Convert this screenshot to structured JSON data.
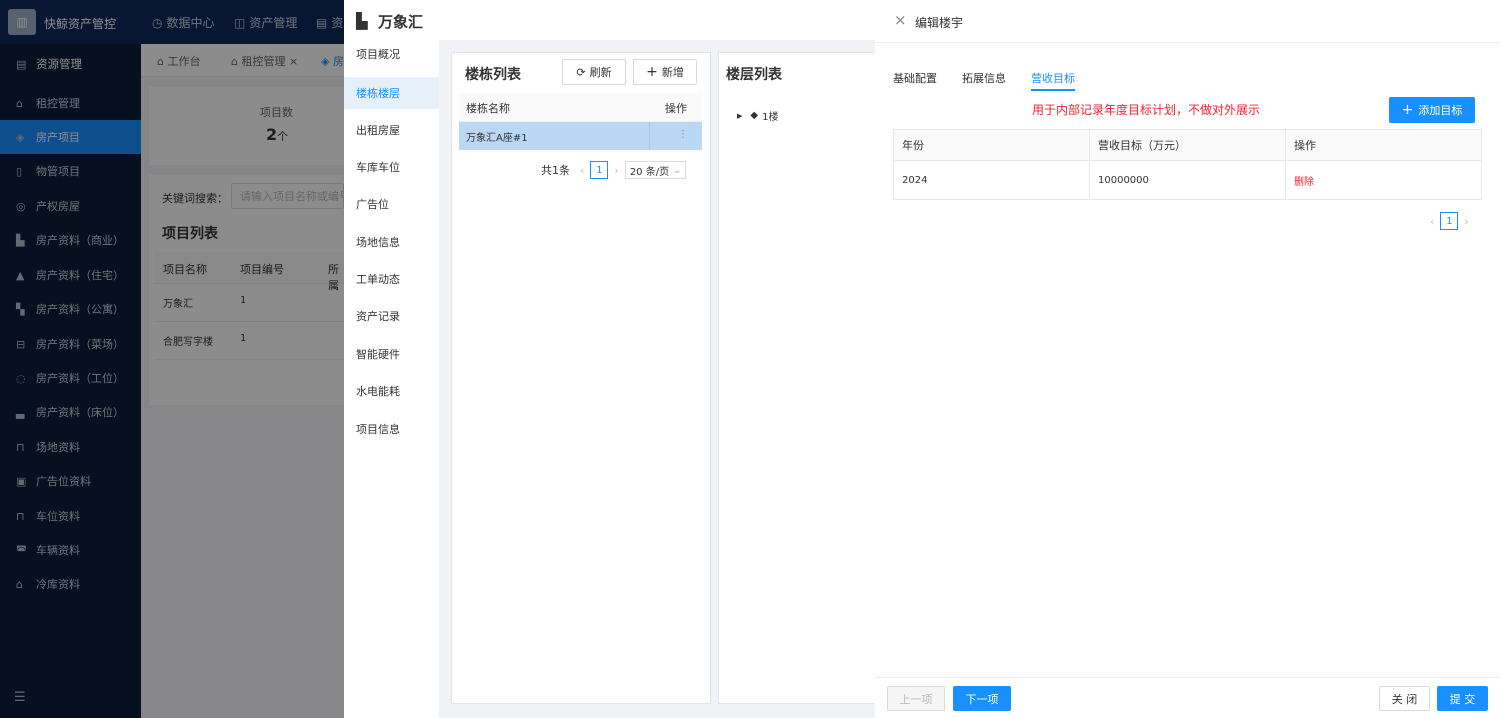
{
  "app": {
    "name": "快鲸资产管控",
    "logo_icon": "building-icon"
  },
  "topnav": [
    {
      "label": "数据中心",
      "icon": "chart-icon"
    },
    {
      "label": "资产管理",
      "icon": "cube-icon"
    },
    {
      "label": "资",
      "icon": "building-icon"
    }
  ],
  "sidebar": {
    "header": "资源管理",
    "items": [
      {
        "label": "租控管理",
        "icon": "home-icon"
      },
      {
        "label": "房产项目",
        "icon": "layers-icon",
        "active": true
      },
      {
        "label": "物管项目",
        "icon": "doc-icon"
      },
      {
        "label": "产权房屋",
        "icon": "stack-icon"
      },
      {
        "label": "房产资料（商业）",
        "icon": "shop-icon"
      },
      {
        "label": "房产资料（住宅）",
        "icon": "house-icon"
      },
      {
        "label": "房产资料（公寓）",
        "icon": "apartment-icon"
      },
      {
        "label": "房产资料（菜场）",
        "icon": "market-icon"
      },
      {
        "label": "房产资料（工位）",
        "icon": "desk-icon"
      },
      {
        "label": "房产资料（床位）",
        "icon": "bed-icon"
      },
      {
        "label": "场地资料",
        "icon": "field-icon"
      },
      {
        "label": "广告位资料",
        "icon": "ad-icon"
      },
      {
        "label": "车位资料",
        "icon": "parking-icon"
      },
      {
        "label": "车辆资料",
        "icon": "car-icon"
      },
      {
        "label": "冷库资料",
        "icon": "warehouse-icon"
      }
    ],
    "collapse_icon": "menu-fold-icon"
  },
  "worktabs": [
    "工作台",
    "租控管理",
    "房"
  ],
  "stat": {
    "label": "项目数",
    "value": "2",
    "unit": "个"
  },
  "search": {
    "label": "关键词搜索：",
    "placeholder": "请输入项目名称或编号"
  },
  "project_list": {
    "title": "项目列表",
    "columns": [
      "项目名称",
      "项目编号",
      "所属"
    ],
    "rows": [
      [
        "万象汇",
        "1"
      ],
      [
        "合肥写字楼",
        "1"
      ]
    ]
  },
  "project_drawer": {
    "title": "万象汇",
    "nav": [
      "项目概况",
      "楼栋楼层",
      "出租房屋",
      "车库车位",
      "广告位",
      "场地信息",
      "工单动态",
      "资产记录",
      "智能硬件",
      "水电能耗",
      "项目信息"
    ],
    "active_nav": 1,
    "building_panel": {
      "title": "楼栋列表",
      "refresh": "刷新",
      "add": "新增",
      "columns": [
        "楼栋名称",
        "操作"
      ],
      "rows": [
        {
          "name": "万象汇A座#1",
          "op": "⋮"
        }
      ],
      "pagination": {
        "total": "共1条",
        "page": "1",
        "size": "20 条/页"
      }
    },
    "floor_panel": {
      "title": "楼层列表",
      "floors": [
        "1楼"
      ]
    }
  },
  "edit_drawer": {
    "title": "编辑楼宇",
    "tabs": [
      "基础配置",
      "拓展信息",
      "营收目标"
    ],
    "active_tab": 2,
    "note": "用于内部记录年度目标计划，不做对外展示",
    "add_button": "添加目标",
    "columns": [
      "年份",
      "营收目标（万元）",
      "操作"
    ],
    "rows": [
      {
        "year": "2024",
        "target": "10000000",
        "op": "删除"
      }
    ],
    "page": "1",
    "footer": {
      "prev": "上一项",
      "next": "下一项",
      "close": "关 闭",
      "submit": "提 交"
    }
  },
  "colors": {
    "primary": "#1890ff",
    "danger": "#f5222d",
    "nav": "#0c1e3c"
  }
}
